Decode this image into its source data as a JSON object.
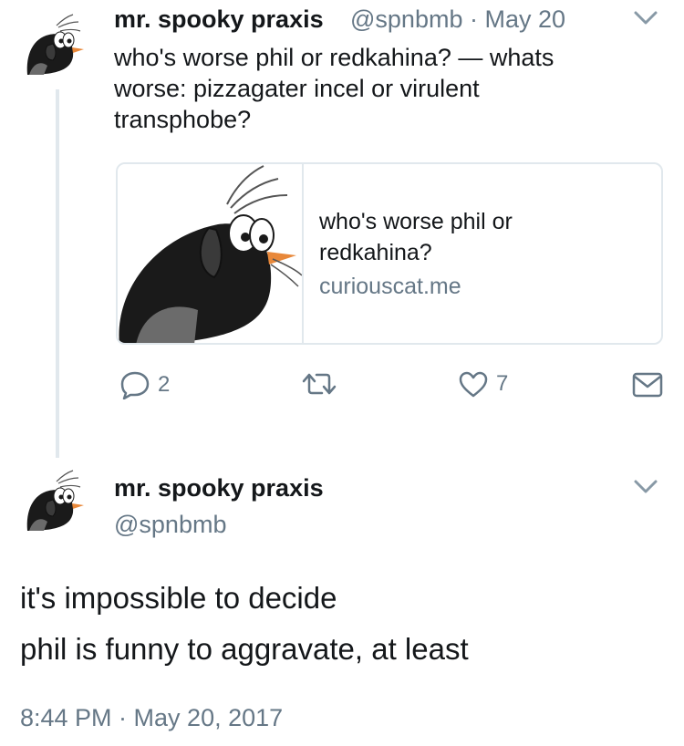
{
  "tweet1": {
    "display_name": "mr. spooky praxis",
    "meta": "@spnbmb · May 20",
    "text_line1": "who's worse phil or redkahina? — whats",
    "text_line2": "worse: pizzagater incel or virulent",
    "text_line3": "transphobe?",
    "card": {
      "title_line1": "who's worse phil or",
      "title_line2": "redkahina?",
      "domain": "curiouscat.me"
    },
    "actions": {
      "replies": "2",
      "likes": "7"
    }
  },
  "tweet2": {
    "display_name": "mr. spooky praxis",
    "handle": "@spnbmb",
    "text_line1": "it's impossible to decide",
    "text_line2": "phil is funny to aggravate, at least",
    "timestamp": "8:44 PM · May 20, 2017"
  },
  "colors": {
    "text": "#14171a",
    "muted": "#657786",
    "border": "#e1e8ed"
  },
  "icons": [
    "mole-avatar",
    "chevron-down-icon",
    "reply-icon",
    "retweet-icon",
    "like-icon",
    "dm-icon"
  ]
}
